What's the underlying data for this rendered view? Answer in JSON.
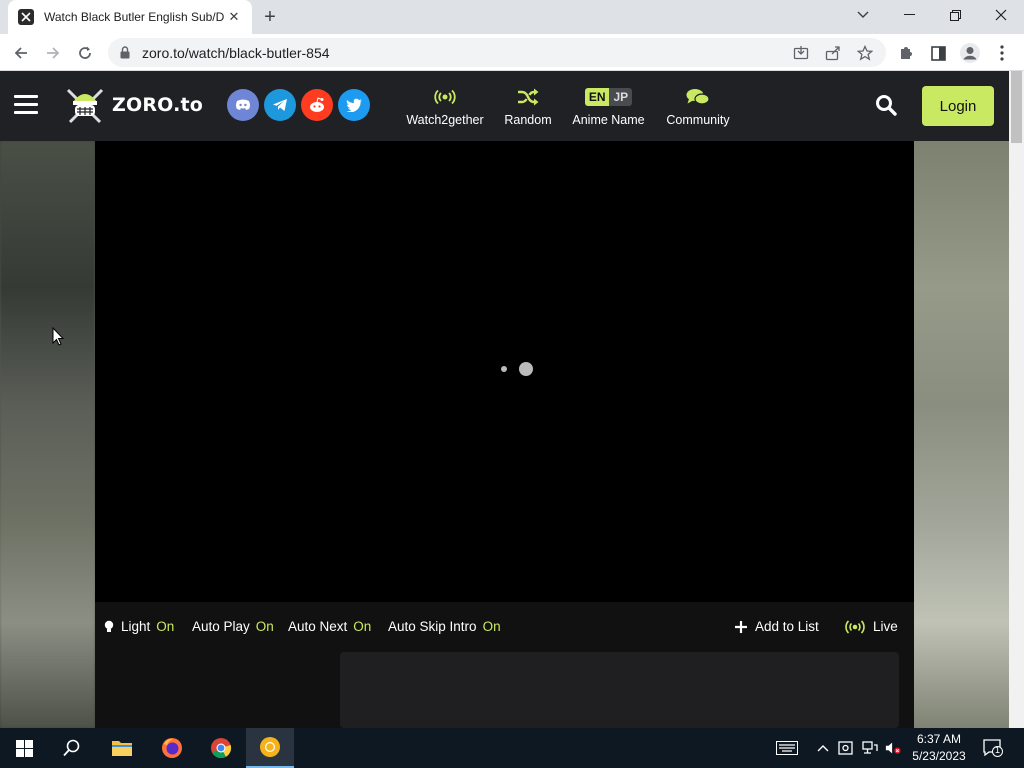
{
  "browser": {
    "tab_title": "Watch Black Butler English Sub/Dub online Free on Zoro.to",
    "url": "zoro.to/watch/black-butler-854"
  },
  "site": {
    "logo_text": "ZORO.to",
    "nav": [
      {
        "label": "Watch2gether",
        "icon": "broadcast-icon"
      },
      {
        "label": "Random",
        "icon": "shuffle-icon"
      },
      {
        "label": "Anime Name",
        "icon": "language-toggle"
      },
      {
        "label": "Community",
        "icon": "chat-bubbles-icon"
      }
    ],
    "lang_en": "EN",
    "lang_jp": "JP",
    "login_label": "Login",
    "socials": [
      "discord-icon",
      "telegram-icon",
      "reddit-icon",
      "twitter-icon"
    ],
    "accent_color": "#cae962"
  },
  "player": {
    "controls": {
      "light_label": "Light",
      "light_state": "On",
      "autoplay_label": "Auto Play",
      "autoplay_state": "On",
      "autonext_label": "Auto Next",
      "autonext_state": "On",
      "autoskip_label": "Auto Skip Intro",
      "autoskip_state": "On",
      "add_to_list": "Add to List",
      "live": "Live"
    }
  },
  "taskbar": {
    "time": "6:37 AM",
    "date": "5/23/2023",
    "notification_count": "1"
  }
}
